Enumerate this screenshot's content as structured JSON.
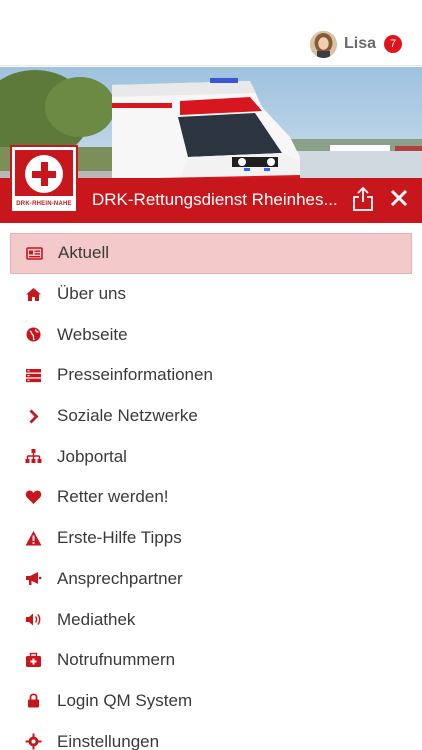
{
  "user": {
    "name": "Lisa",
    "badge_count": "7"
  },
  "header": {
    "title": "DRK-Rettungsdienst Rheinhes...",
    "logo_text": "DRK-RHEIN-NAHE"
  },
  "colors": {
    "brand_red": "#c8161d",
    "active_bg": "#f3c9ca",
    "badge_red": "#e0141b"
  },
  "menu": {
    "items": [
      {
        "label": "Aktuell",
        "icon": "newspaper-icon",
        "active": true
      },
      {
        "label": "Über uns",
        "icon": "home-icon"
      },
      {
        "label": "Webseite",
        "icon": "globe-icon"
      },
      {
        "label": "Presseinformationen",
        "icon": "list-icon"
      },
      {
        "label": "Soziale Netzwerke",
        "icon": "chevron-right-icon"
      },
      {
        "label": "Jobportal",
        "icon": "sitemap-icon"
      },
      {
        "label": "Retter werden!",
        "icon": "heart-icon"
      },
      {
        "label": "Erste-Hilfe Tipps",
        "icon": "warning-icon"
      },
      {
        "label": "Ansprechpartner",
        "icon": "megaphone-icon"
      },
      {
        "label": "Mediathek",
        "icon": "speaker-icon"
      },
      {
        "label": "Notrufnummern",
        "icon": "medkit-icon"
      },
      {
        "label": "Login QM System",
        "icon": "lock-icon"
      },
      {
        "label": "Einstellungen",
        "icon": "gear-icon"
      }
    ]
  }
}
